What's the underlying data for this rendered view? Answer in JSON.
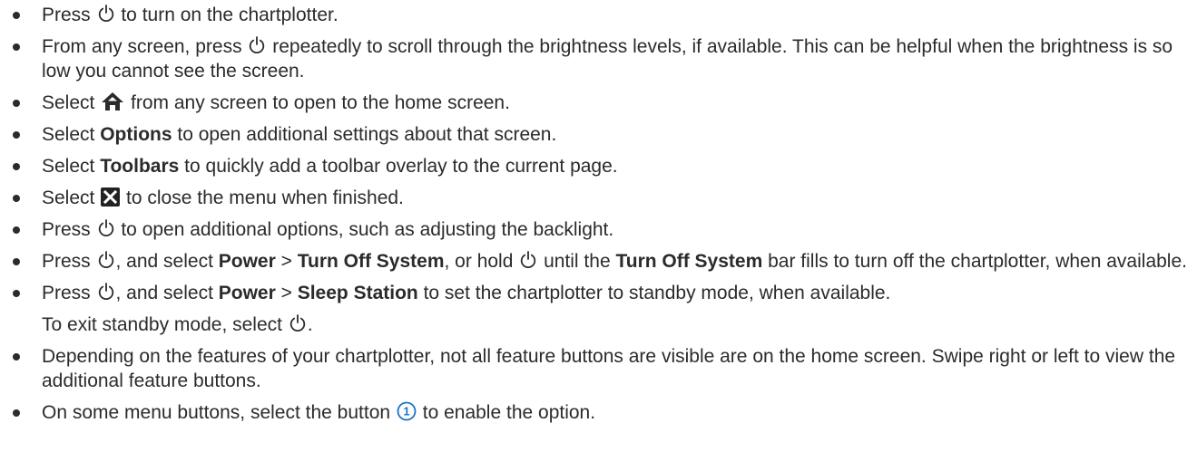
{
  "items": [
    {
      "a": "Press ",
      "icon": "power-icon",
      "b": " to turn on the chartplotter."
    },
    {
      "a": "From any screen, press ",
      "icon": "power-icon",
      "b": " repeatedly to scroll through the brightness levels, if available. This can be helpful when the brightness is so low you cannot see the screen."
    },
    {
      "a": "Select ",
      "icon": "home-icon",
      "b": " from any screen to open to the home screen."
    },
    {
      "a": "Select ",
      "bold": "Options",
      "b": " to open additional settings about that screen."
    },
    {
      "a": "Select ",
      "bold": "Toolbars",
      "b": " to quickly add a toolbar overlay to the current page."
    },
    {
      "a": "Select ",
      "icon": "close-icon",
      "b": " to close the menu when finished."
    },
    {
      "a": "Press ",
      "icon": "power-icon",
      "b": " to open additional options, such as adjusting the backlight."
    },
    {
      "p1": "Press ",
      "p2": ", and select ",
      "p3": "Power",
      "p4": " > ",
      "p5": "Turn Off System",
      "p6": ", or hold ",
      "p7": " until the ",
      "p8": "Turn Off System",
      "p9": " bar fills to turn off the chartplotter, when available."
    },
    {
      "p1": "Press ",
      "p2": ", and select ",
      "p3": "Power",
      "p4": " > ",
      "p5": "Sleep Station",
      "p6": " to set the chartplotter to standby mode, when available.",
      "cont_a": "To exit standby mode, select ",
      "cont_b": "."
    },
    {
      "text": "Depending on the features of your chartplotter, not all feature buttons are visible are on the home screen. Swipe right or left to view the additional feature buttons."
    },
    {
      "a": "On some menu buttons, select the button ",
      "callout": "1",
      "b": " to enable the option."
    }
  ],
  "colors": {
    "text": "#2b2b2b",
    "callout": "#1a73c7",
    "close_bg": "#222222"
  }
}
